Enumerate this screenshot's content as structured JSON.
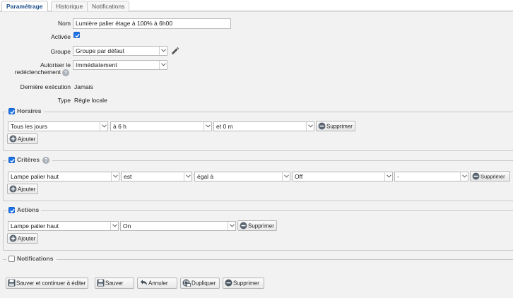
{
  "tabs": [
    {
      "label": "Paramétrage",
      "active": true
    },
    {
      "label": "Historique",
      "active": false
    },
    {
      "label": "Notifications",
      "active": false
    }
  ],
  "form": {
    "name_label": "Nom",
    "name_value": "Lumière palier étage à 100% à 6h00",
    "enabled_label": "Activée",
    "enabled_checked": true,
    "group_label": "Groupe",
    "group_value": "Groupe par défaut",
    "retrigger_label_1": "Autoriser le",
    "retrigger_label_2": "redéclenchement",
    "retrigger_value": "Immédiatement",
    "last_exec_label": "Dernière exécution",
    "last_exec_value": "Jamais",
    "type_label": "Type",
    "type_value": "Règle locale"
  },
  "schedules": {
    "legend": "Horaires",
    "checked": true,
    "rows": [
      {
        "day": "Tous les jours",
        "hour": "à 6 h",
        "minute": "et 0 m",
        "remove_label": "Supprimer"
      }
    ],
    "add_label": "Ajouter"
  },
  "criteria": {
    "legend": "Critères",
    "checked": true,
    "help": "?",
    "rows": [
      {
        "device": "Lampe palier haut",
        "property": "est",
        "operator": "égal à",
        "value": "Off",
        "extra": "-",
        "remove_label": "Supprimer"
      }
    ],
    "add_label": "Ajouter"
  },
  "actions": {
    "legend": "Actions",
    "checked": true,
    "rows": [
      {
        "device": "Lampe palier haut",
        "value": "On",
        "remove_label": "Supprimer"
      }
    ],
    "add_label": "Ajouter"
  },
  "notifications": {
    "legend": "Notifications",
    "checked": false
  },
  "footer": {
    "save_continue_label": "Sauver et continuer à éditer",
    "save_label": "Sauver",
    "cancel_label": "Annuler",
    "duplicate_label": "Dupliquer",
    "delete_label": "Supprimer"
  },
  "colors": {
    "accent": "#1a73e8",
    "tab_active_text": "#1b4f8a",
    "panel_bg": "#f2f2f2"
  }
}
